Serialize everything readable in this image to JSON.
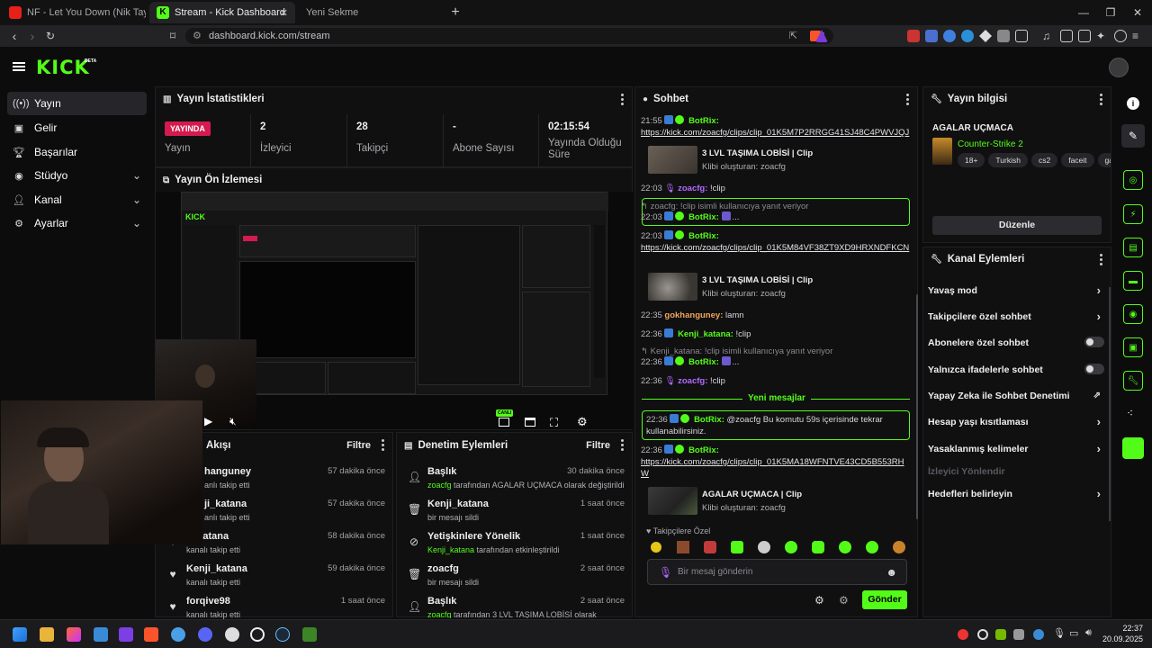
{
  "browser": {
    "tabs": [
      {
        "title": "NF - Let You Down (Nik Taylor Techno Edit)",
        "display": "NF - Let You Down (Nik Taylor Techn",
        "active": false
      },
      {
        "title": "Stream - Kick Dashboard",
        "active": true
      },
      {
        "title": "Yeni Sekme",
        "active": false
      }
    ],
    "url": "dashboard.kick.com/stream",
    "ext_badge": "3"
  },
  "kick": {
    "logo": "KICK",
    "beta": "BETA",
    "accent": "#53fc18"
  },
  "sidebar": {
    "items": [
      {
        "label": "Yayın",
        "icon": "broadcast-icon",
        "active": true
      },
      {
        "label": "Gelir",
        "icon": "dollar-icon"
      },
      {
        "label": "Başarılar",
        "icon": "trophy-icon"
      },
      {
        "label": "Stüdyo",
        "icon": "studio-icon",
        "expandable": true
      },
      {
        "label": "Kanal",
        "icon": "channel-icon",
        "expandable": true
      },
      {
        "label": "Ayarlar",
        "icon": "gear-icon",
        "expandable": true
      }
    ]
  },
  "stats": {
    "title": "Yayın İstatistikleri",
    "live_badge": "YAYINDA",
    "live_label": "Yayın",
    "viewers_value": "2",
    "viewers_label": "İzleyici",
    "followers_value": "28",
    "followers_label": "Takipçi",
    "subs_value": "-",
    "subs_label": "Abone Sayısı",
    "duration_value": "02:15:54",
    "duration_label": "Yayında Olduğu Süre"
  },
  "preview": {
    "title": "Yayın Ön İzlemesi",
    "live_label": "CANLI"
  },
  "activity": {
    "title": "Akışı",
    "filter": "Filtre",
    "rows": [
      {
        "user": "hanguney",
        "text": "anlı takip etti",
        "time": "57 dakika önce"
      },
      {
        "user": "ji_katana",
        "text": "anlı takip etti",
        "time": "57 dakika önce"
      },
      {
        "user": "ji_katana",
        "text": "kanalı takip etti",
        "time": "58 dakika önce"
      },
      {
        "user": "Kenji_katana",
        "text": "kanalı takip etti",
        "time": "59 dakika önce"
      },
      {
        "user": "forqive98",
        "text": "kanalı takip etti",
        "time": "1 saat önce"
      }
    ]
  },
  "moderation": {
    "title": "Denetim Eylemleri",
    "filter": "Filtre",
    "rows": [
      {
        "title": "Başlık",
        "user": "zoacfg",
        "text": " tarafından AGALAR UÇMACA olarak değiştirildi",
        "time": "30 dakika önce"
      },
      {
        "title": "Kenji_katana",
        "user": "",
        "text": "bir mesajı sildi",
        "time": "1 saat önce"
      },
      {
        "title": "Yetişkinlere Yönelik",
        "user": "Kenji_katana",
        "text": " tarafından etkinleştirildi",
        "time": "1 saat önce"
      },
      {
        "title": "zoacfg",
        "user": "",
        "text": "bir mesajı sildi",
        "time": "2 saat önce"
      },
      {
        "title": "Başlık",
        "user": "zoacfg",
        "text": " tarafından 3 LVL TAŞIMA LOBİSİ olarak",
        "time": "2 saat önce"
      }
    ]
  },
  "chat": {
    "title": "Sohbet",
    "messages": [
      {
        "time": "21:55",
        "user": "BotRix",
        "link": "https://kick.com/zoacfg/clips/clip_01K5M7P2RRGG41SJ48C4PWVJQJ"
      },
      {
        "clip_title": "3 LVL TAŞIMA LOBİSİ | Clip",
        "clip_sub": "Klibi oluşturan: zoacfg"
      },
      {
        "time": "22:03",
        "user": "zoacfg",
        "text": "!clip"
      },
      {
        "reply": "zoacfg: !clip isimli kullanıcıya yanıt veriyor",
        "time": "22:03",
        "user": "BotRix",
        "text": "..."
      },
      {
        "time": "22:03",
        "user": "BotRix",
        "link": "https://kick.com/zoacfg/clips/clip_01K5M84VF38ZT9XD9HRXNDFKCN"
      },
      {
        "clip_title": "3 LVL TAŞIMA LOBİSİ | Clip",
        "clip_sub": "Klibi oluşturan: zoacfg"
      },
      {
        "time": "22:35",
        "user": "gokhanguney",
        "text": "lamn"
      },
      {
        "time": "22:36",
        "user": "Kenji_katana",
        "text": "!clip"
      },
      {
        "reply": "Kenji_katana: !clip isimli kullanıcıya yanıt veriyor",
        "time": "22:36",
        "user": "BotRix",
        "text": "..."
      },
      {
        "time": "22:36",
        "user": "zoacfg",
        "text": "!clip"
      },
      {
        "divider": "Yeni mesajlar"
      },
      {
        "time": "22:36",
        "user": "BotRix",
        "text": "@zoacfg Bu komutu 59s içerisinde tekrar kullanabilirsiniz."
      },
      {
        "time": "22:36",
        "user": "BotRix",
        "link": "https://kick.com/zoacfg/clips/clip_01K5MA18WFNTVE43CD5B553RHW"
      },
      {
        "clip_title": "AGALAR UÇMACA | Clip",
        "clip_sub": "Klibi oluşturan: zoacfg"
      }
    ],
    "followers_only": "Takipçilere Özel",
    "placeholder": "Bir mesaj gönderin",
    "send": "Gönder"
  },
  "stream_info": {
    "title": "Yayın bilgisi",
    "stream_title": "AGALAR UÇMACA",
    "category": "Counter-Strike 2",
    "tags": [
      "18+",
      "Turkish",
      "cs2",
      "faceit",
      "gam"
    ],
    "edit": "Düzenle"
  },
  "channel_actions": {
    "title": "Kanal Eylemleri",
    "items": [
      {
        "label": "Yavaş mod",
        "control": "arrow"
      },
      {
        "label": "Takipçilere özel sohbet",
        "control": "arrow"
      },
      {
        "label": "Abonelere özel sohbet",
        "control": "toggle"
      },
      {
        "label": "Yalnızca ifadelerle sohbet",
        "control": "toggle"
      },
      {
        "label": "Yapay Zeka ile Sohbet Denetimi",
        "control": "external"
      },
      {
        "label": "Hesap yaşı kısıtlaması",
        "control": "arrow"
      },
      {
        "label": "Yasaklanmış kelimeler",
        "control": "arrow"
      },
      {
        "label": "İzleyici Yönlendir",
        "control": "none",
        "disabled": true
      },
      {
        "label": "Hedefleri belirleyin",
        "control": "arrow"
      }
    ]
  },
  "taskbar": {
    "time": "22:37",
    "date": "20.09.2025"
  }
}
